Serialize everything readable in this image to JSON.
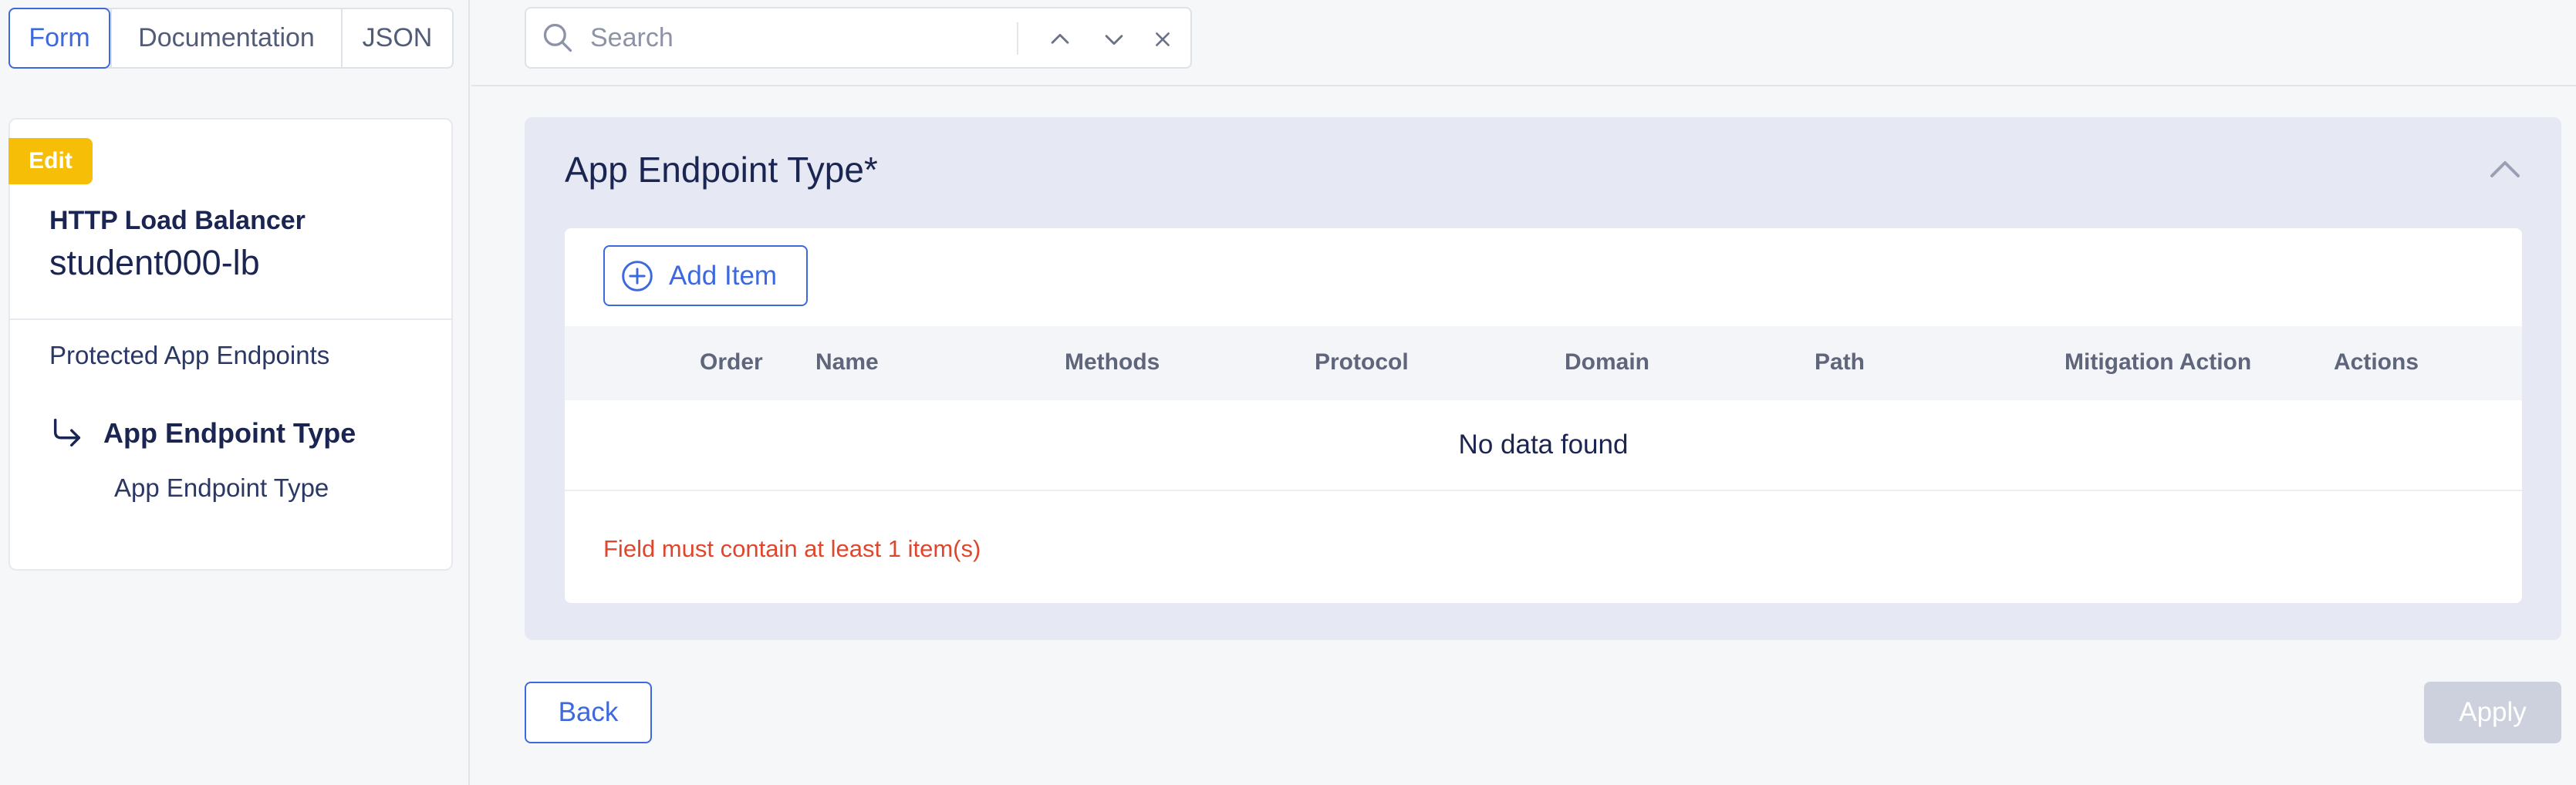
{
  "view_tabs": [
    "Form",
    "Documentation",
    "JSON"
  ],
  "active_view_tab": "Form",
  "search": {
    "placeholder": "Search",
    "value": ""
  },
  "sidebar": {
    "badge": "Edit",
    "resource_type": "HTTP Load Balancer",
    "resource_name": "student000-lb",
    "nav": {
      "parent": "Protected App Endpoints",
      "current": "App Endpoint Type",
      "child": "App Endpoint Type"
    }
  },
  "section": {
    "title": "App Endpoint Type",
    "required_marker": "*",
    "add_item_label": "Add Item",
    "table": {
      "columns": [
        "Order",
        "Name",
        "Methods",
        "Protocol",
        "Domain",
        "Path",
        "Mitigation Action",
        "Actions"
      ],
      "empty_text": "No data found"
    },
    "validation_error": "Field must contain at least 1 item(s)"
  },
  "footer": {
    "back_label": "Back",
    "apply_label": "Apply",
    "apply_enabled": false
  },
  "colors": {
    "accent": "#3d68de",
    "badge": "#f7be07",
    "error": "#e0462d",
    "section_bg": "#e6e8f3"
  }
}
